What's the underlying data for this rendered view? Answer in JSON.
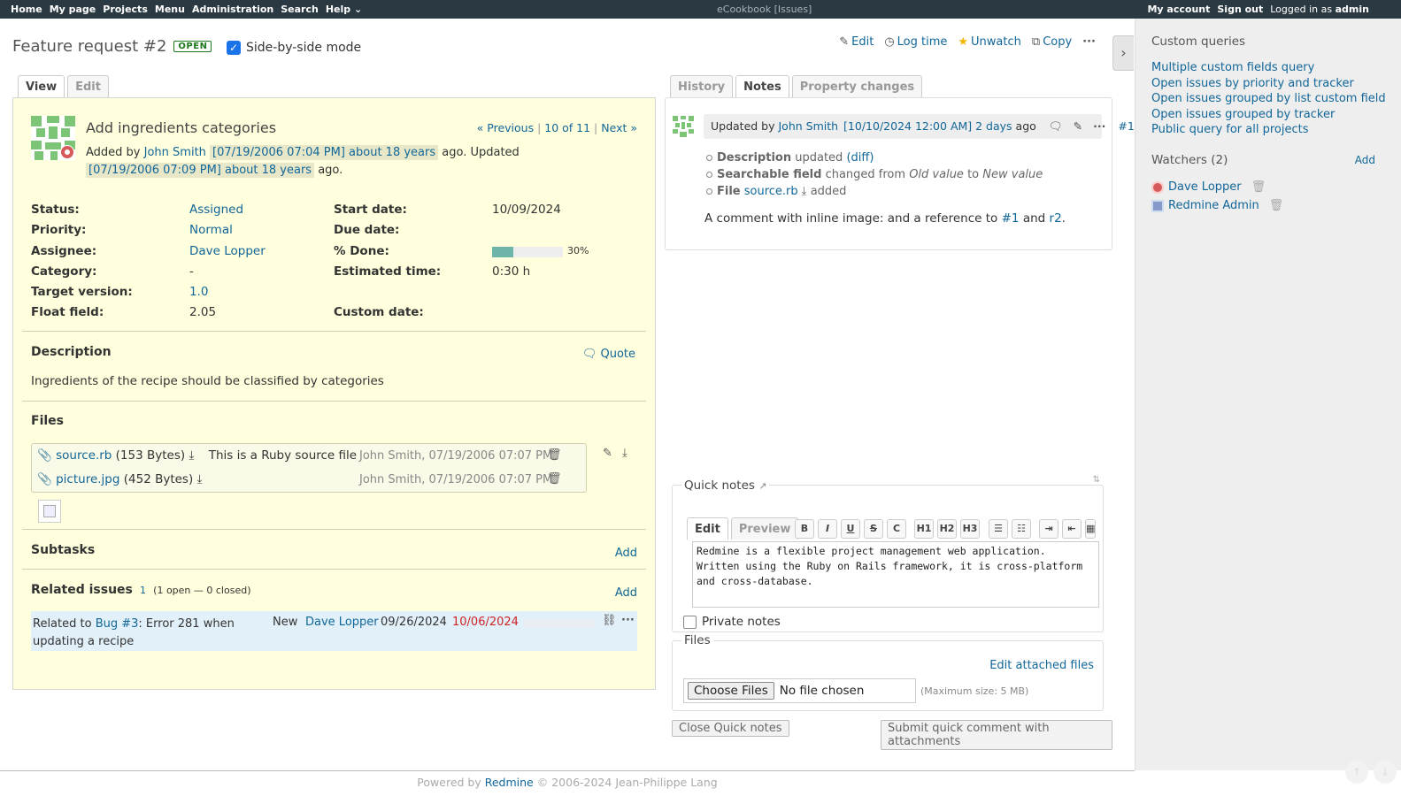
{
  "top_menu": {
    "items": [
      "Home",
      "My page",
      "Projects",
      "Menu",
      "Administration",
      "Search",
      "Help"
    ],
    "center": "eCookbook  [Issues]",
    "my_account": "My account",
    "sign_out": "Sign out",
    "logged_in_prefix": "Logged in as",
    "user": "admin"
  },
  "issue": {
    "title": "Feature request #2",
    "status_badge": "OPEN",
    "side_by_side_label": "Side-by-side mode",
    "actions": {
      "edit": "Edit",
      "log_time": "Log time",
      "unwatch": "Unwatch",
      "copy": "Copy"
    },
    "tabs": [
      "View",
      "Edit"
    ],
    "subject": "Add ingredients categories",
    "nav": {
      "previous": "« Previous",
      "position": "10 of 11",
      "next": "Next »"
    },
    "author": {
      "added_by": "Added by",
      "name": "John Smith",
      "created": "[07/19/2006 07:04 PM] about 18 years",
      "ago_updated": "ago. Updated",
      "updated": "[07/19/2006 07:09 PM] about 18 years",
      "ago": "ago."
    },
    "attributes_left": [
      {
        "label": "Status:",
        "value": "Assigned",
        "link": true
      },
      {
        "label": "Priority:",
        "value": "Normal",
        "link": true
      },
      {
        "label": "Assignee:",
        "value": "Dave Lopper",
        "link": true
      },
      {
        "label": "Category:",
        "value": "-",
        "link": false
      },
      {
        "label": "Target version:",
        "value": "1.0",
        "link": true
      },
      {
        "label": "Float field:",
        "value": "2.05",
        "link": false
      }
    ],
    "attributes_right": [
      {
        "label": "Start date:",
        "value": "10/09/2024"
      },
      {
        "label": "Due date:",
        "value": ""
      },
      {
        "label": "% Done:",
        "value": "30%"
      },
      {
        "label": "Estimated time:",
        "value": "0:30 h"
      },
      {
        "label": "",
        "value": ""
      },
      {
        "label": "Custom date:",
        "value": ""
      }
    ],
    "done_fraction": 0.3,
    "description_title": "Description",
    "quote": "Quote",
    "description": "Ingredients of the recipe should be classified by categories",
    "files_title": "Files",
    "files": [
      {
        "name": "source.rb",
        "size": "(153 Bytes)",
        "desc": "This is a Ruby source file",
        "meta": "John Smith, 07/19/2006 07:07 PM"
      },
      {
        "name": "picture.jpg",
        "size": "(452 Bytes)",
        "desc": "",
        "meta": "John Smith, 07/19/2006 07:07 PM"
      }
    ],
    "subtasks_title": "Subtasks",
    "add": "Add",
    "related_title": "Related issues",
    "related_count": "1",
    "related_summary": "(1 open — 0 closed)",
    "related": {
      "prefix": "Related to",
      "link": "Bug #3",
      "text": ": Error 281 when updating a recipe",
      "status": "New",
      "assignee": "Dave Lopper",
      "start": "09/26/2024",
      "due": "10/06/2024"
    }
  },
  "history": {
    "tabs": [
      "History",
      "Notes",
      "Property changes"
    ],
    "journal": {
      "updated_by": "Updated by",
      "user": "John Smith",
      "stamp": "[10/10/2024 12:00 AM] 2 days",
      "ago": "ago",
      "number": "#1"
    },
    "changes": [
      {
        "field": "Description",
        "text": "updated",
        "link": "(diff)"
      },
      {
        "field": "Searchable field",
        "text": "changed from",
        "old": "Old value",
        "to": "to",
        "new": "New value"
      },
      {
        "field": "File",
        "link": "source.rb",
        "text": "added"
      }
    ],
    "comment": {
      "text1": "A comment with inline image:  and a reference to",
      "ref1": "#1",
      "and": "and",
      "ref2": "r2",
      "end": "."
    }
  },
  "quick_notes": {
    "legend": "Quick notes",
    "tabs": [
      "Edit",
      "Preview"
    ],
    "toolbar": [
      "B",
      "I",
      "U",
      "S",
      "C",
      "H1",
      "H2",
      "H3"
    ],
    "text": "Redmine is a flexible project management web application.\nWritten using the Ruby on Rails framework, it is cross-platform\nand cross-database.",
    "private_label": "Private notes",
    "files_legend": "Files",
    "edit_attached": "Edit attached files",
    "choose_files": "Choose Files",
    "no_file": "No file chosen",
    "max_size": "(Maximum size: 5 MB)",
    "close": "Close Quick notes",
    "submit": "Submit quick comment with attachments"
  },
  "sidebar": {
    "custom_queries_title": "Custom queries",
    "queries": [
      "Multiple custom fields query",
      "Open issues by priority and tracker",
      "Open issues grouped by list custom field",
      "Open issues grouped by tracker",
      "Public query for all projects"
    ],
    "watchers_title": "Watchers (2)",
    "watchers_add": "Add",
    "watchers": [
      "Dave Lopper",
      "Redmine Admin"
    ]
  },
  "footer": {
    "powered": "Powered by",
    "redmine": "Redmine",
    "copy": "© 2006-2024 Jean-Philippe Lang"
  }
}
